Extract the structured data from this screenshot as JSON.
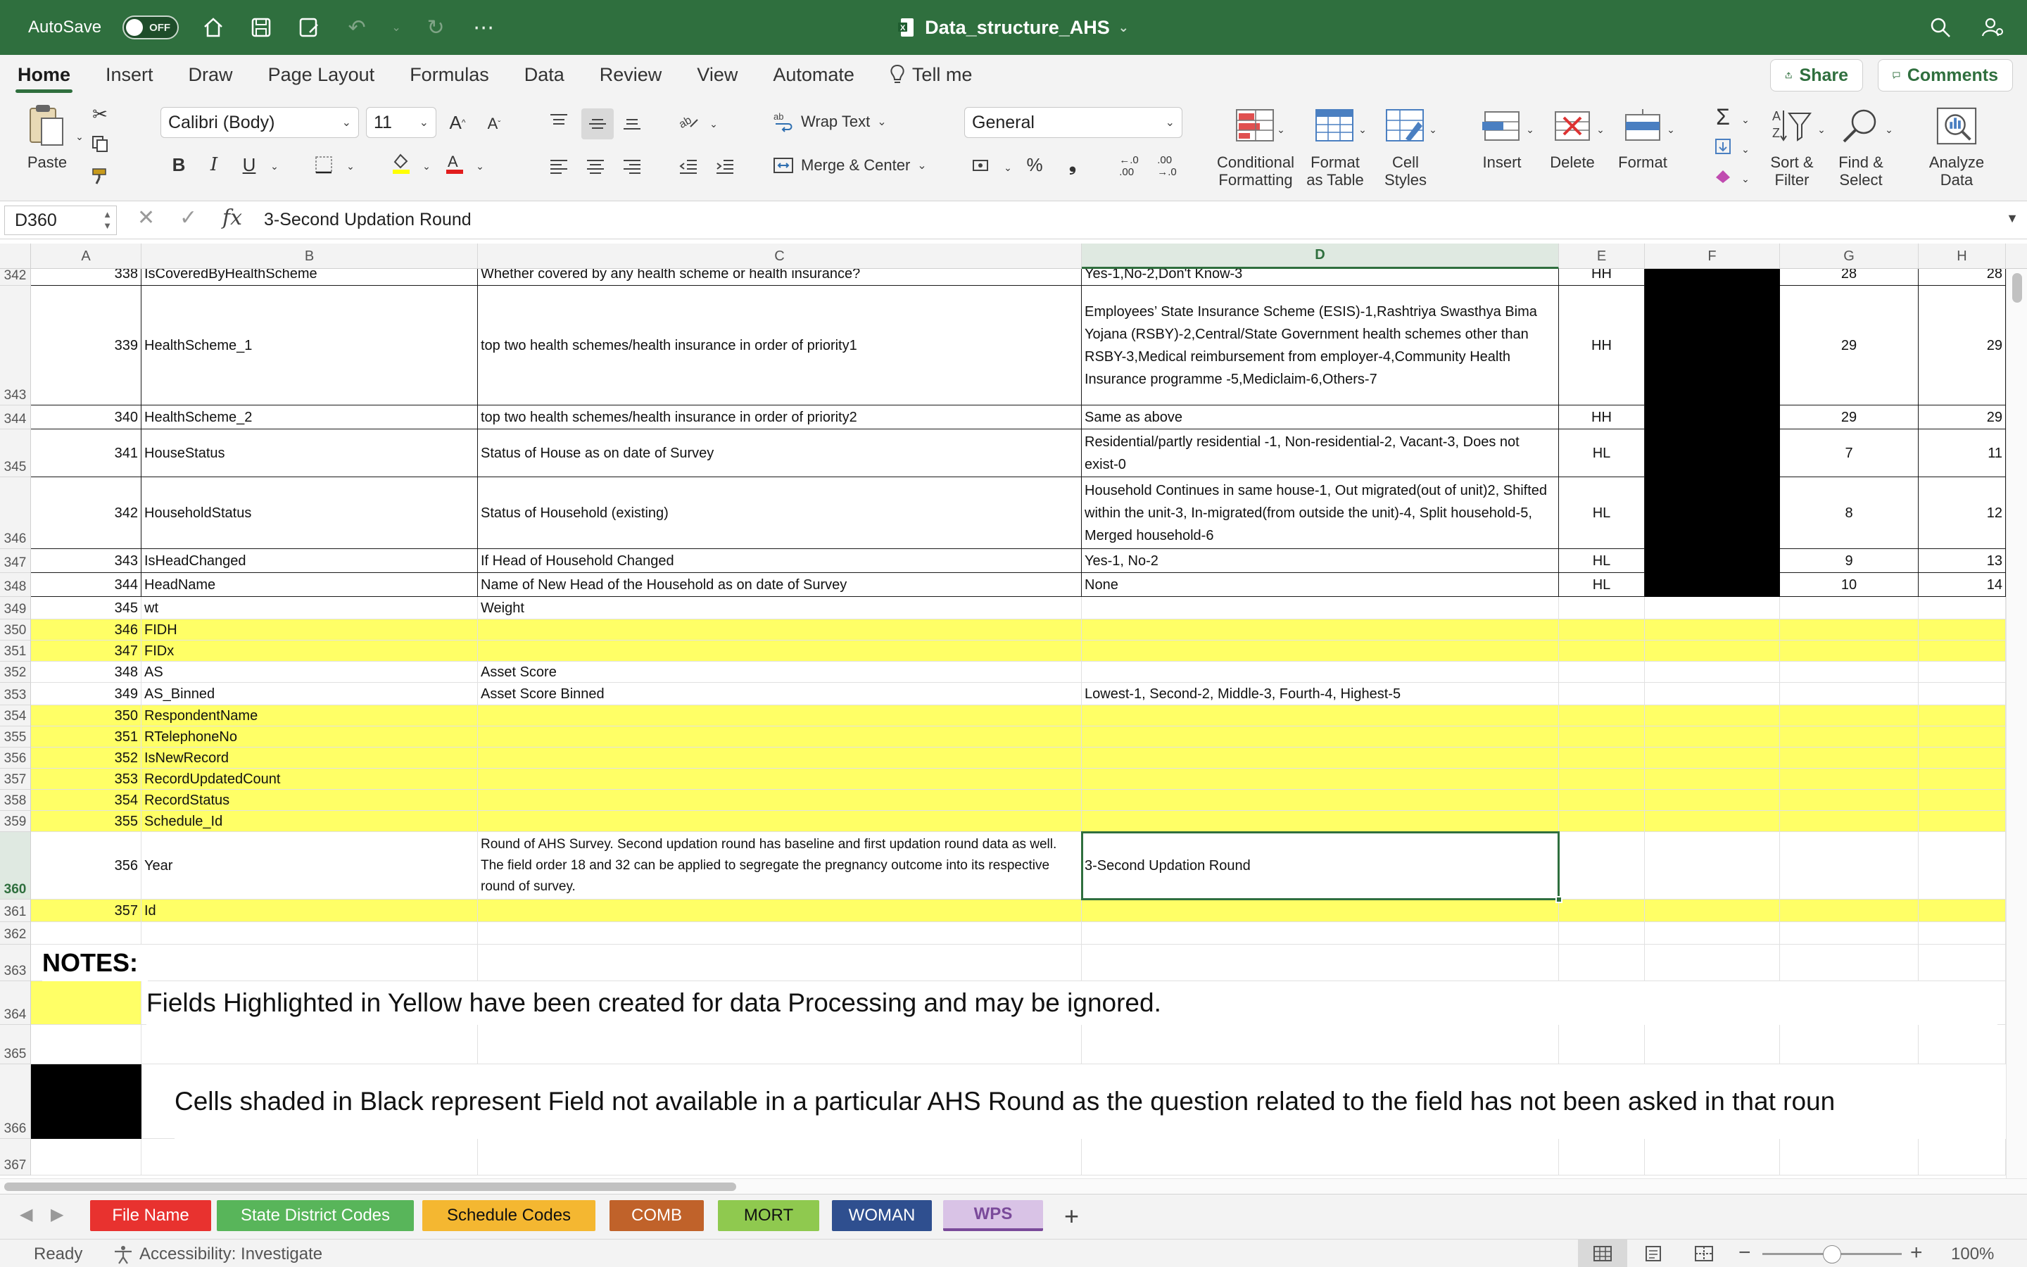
{
  "titlebar": {
    "autosave_label": "AutoSave",
    "autosave_state": "OFF",
    "doc_title": "Data_structure_AHS"
  },
  "ribbon_tabs": [
    "Home",
    "Insert",
    "Draw",
    "Page Layout",
    "Formulas",
    "Data",
    "Review",
    "View",
    "Automate"
  ],
  "tell_me": "Tell me",
  "share_label": "Share",
  "comments_label": "Comments",
  "ribbon": {
    "paste": "Paste",
    "font_name": "Calibri (Body)",
    "font_size": "11",
    "wrap_text": "Wrap Text",
    "merge_center": "Merge & Center",
    "number_format": "General",
    "conditional_formatting": [
      "Conditional",
      "Formatting"
    ],
    "format_as_table": [
      "Format",
      "as Table"
    ],
    "cell_styles": [
      "Cell",
      "Styles"
    ],
    "insert": "Insert",
    "delete": "Delete",
    "format": "Format",
    "sort_filter": [
      "Sort &",
      "Filter"
    ],
    "find_select": [
      "Find &",
      "Select"
    ],
    "analyze_data": [
      "Analyze",
      "Data"
    ]
  },
  "formula_bar": {
    "name_box": "D360",
    "fx": "fx",
    "content": "3-Second Updation Round"
  },
  "columns": [
    "A",
    "B",
    "C",
    "D",
    "E",
    "F",
    "G",
    "H"
  ],
  "selected_column": "D",
  "rows": [
    {
      "row": "342",
      "a": "338",
      "b": "IsCoveredByHealthScheme",
      "c": "Whether covered by any health scheme or health insurance?",
      "d": "Yes-1,No-2,Don't Know-3",
      "e": "HH",
      "g": "28",
      "h": "28"
    },
    {
      "row": "343",
      "a": "339",
      "b": "HealthScheme_1",
      "c": "top two health schemes/health insurance in order of priority1",
      "d": "Employees’ State Insurance Scheme (ESIS)-1,Rashtriya Swasthya Bima Yojana (RSBY)-2,Central/State Government health schemes other than RSBY-3,Medical reimbursement from employer-4,Community Health Insurance programme -5,Mediclaim-6,Others-7",
      "e": "HH",
      "g": "29",
      "h": "29"
    },
    {
      "row": "344",
      "a": "340",
      "b": "HealthScheme_2",
      "c": "top two health schemes/health insurance in order of priority2",
      "d": "Same as above",
      "e": "HH",
      "g": "29",
      "h": "29"
    },
    {
      "row": "345",
      "a": "341",
      "b": "HouseStatus",
      "c": "Status of House as on date of Survey",
      "d": "Residential/partly residential -1, Non-residential-2, Vacant-3, Does not exist-0",
      "e": "HL",
      "g": "7",
      "h": "11"
    },
    {
      "row": "346",
      "a": "342",
      "b": "HouseholdStatus",
      "c": "Status of Household (existing)",
      "d": "Household Continues in same house-1, Out migrated(out of unit)2, Shifted within the unit-3, In-migrated(from outside the unit)-4, Split household-5, Merged household-6",
      "e": "HL",
      "g": "8",
      "h": "12"
    },
    {
      "row": "347",
      "a": "343",
      "b": "IsHeadChanged",
      "c": "If Head of Household Changed",
      "d": "Yes-1, No-2",
      "e": "HL",
      "g": "9",
      "h": "13"
    },
    {
      "row": "348",
      "a": "344",
      "b": "HeadName",
      "c": "Name of New Head of the Household as on date of Survey",
      "d": "None",
      "e": "HL",
      "g": "10",
      "h": "14"
    },
    {
      "row": "349",
      "a": "345",
      "b": "wt",
      "c": "Weight",
      "d": "",
      "e": "",
      "g": "",
      "h": ""
    },
    {
      "row": "350",
      "a": "346",
      "b": "FIDH",
      "c": "",
      "d": "",
      "e": "",
      "g": "",
      "h": ""
    },
    {
      "row": "351",
      "a": "347",
      "b": "FIDx",
      "c": "",
      "d": "",
      "e": "",
      "g": "",
      "h": ""
    },
    {
      "row": "352",
      "a": "348",
      "b": "AS",
      "c": "Asset Score",
      "d": "",
      "e": "",
      "g": "",
      "h": ""
    },
    {
      "row": "353",
      "a": "349",
      "b": "AS_Binned",
      "c": "Asset Score Binned",
      "d": "Lowest-1, Second-2, Middle-3, Fourth-4, Highest-5",
      "e": "",
      "g": "",
      "h": ""
    },
    {
      "row": "354",
      "a": "350",
      "b": "RespondentName",
      "c": "",
      "d": "",
      "e": "",
      "g": "",
      "h": ""
    },
    {
      "row": "355",
      "a": "351",
      "b": "RTelephoneNo",
      "c": "",
      "d": "",
      "e": "",
      "g": "",
      "h": ""
    },
    {
      "row": "356",
      "a": "352",
      "b": "IsNewRecord",
      "c": "",
      "d": "",
      "e": "",
      "g": "",
      "h": ""
    },
    {
      "row": "357",
      "a": "353",
      "b": "RecordUpdatedCount",
      "c": "",
      "d": "",
      "e": "",
      "g": "",
      "h": ""
    },
    {
      "row": "358",
      "a": "354",
      "b": "RecordStatus",
      "c": "",
      "d": "",
      "e": "",
      "g": "",
      "h": ""
    },
    {
      "row": "359",
      "a": "355",
      "b": "Schedule_Id",
      "c": "",
      "d": "",
      "e": "",
      "g": "",
      "h": ""
    },
    {
      "row": "360",
      "a": "356",
      "b": "Year",
      "c": "Round of AHS Survey. Second updation round has baseline and first updation round data as well. The field order 18 and 32 can be applied to segregate the pregnancy outcome into its respective round of survey.",
      "d": "3-Second Updation Round",
      "e": "",
      "g": "",
      "h": ""
    },
    {
      "row": "361",
      "a": "357",
      "b": "Id",
      "c": "",
      "d": "",
      "e": "",
      "g": "",
      "h": ""
    },
    {
      "row": "362"
    },
    {
      "row": "363"
    },
    {
      "row": "364"
    },
    {
      "row": "365"
    },
    {
      "row": "366"
    },
    {
      "row": "367"
    }
  ],
  "notes": {
    "label": "NOTES:",
    "yellow_note": "Fields Highlighted in Yellow have been created for data Processing and may be ignored.",
    "black_note": "Cells shaded in Black represent Field not available in a particular AHS Round as the question related to the field has not been asked in that roun"
  },
  "sheet_tabs": [
    {
      "label": "File Name",
      "bg": "#e8322f",
      "fg": "#ffffff"
    },
    {
      "label": "State District Codes",
      "bg": "#58b55a",
      "fg": "#ffffff"
    },
    {
      "label": "Schedule Codes",
      "bg": "#f4b731",
      "fg": "#111111"
    },
    {
      "label": "COMB",
      "bg": "#c0622a",
      "fg": "#ffffff"
    },
    {
      "label": "MORT",
      "bg": "#8fc94f",
      "fg": "#111111"
    },
    {
      "label": "WOMAN",
      "bg": "#2f4f8f",
      "fg": "#ffffff"
    },
    {
      "label": "WPS",
      "bg": "#d9c3e6",
      "fg": "#7a4a9a"
    }
  ],
  "status": {
    "ready": "Ready",
    "accessibility": "Accessibility: Investigate",
    "zoom": "100%"
  },
  "colors": {
    "brand_green": "#2f6f3e",
    "highlight_yellow": "#ffff66"
  }
}
